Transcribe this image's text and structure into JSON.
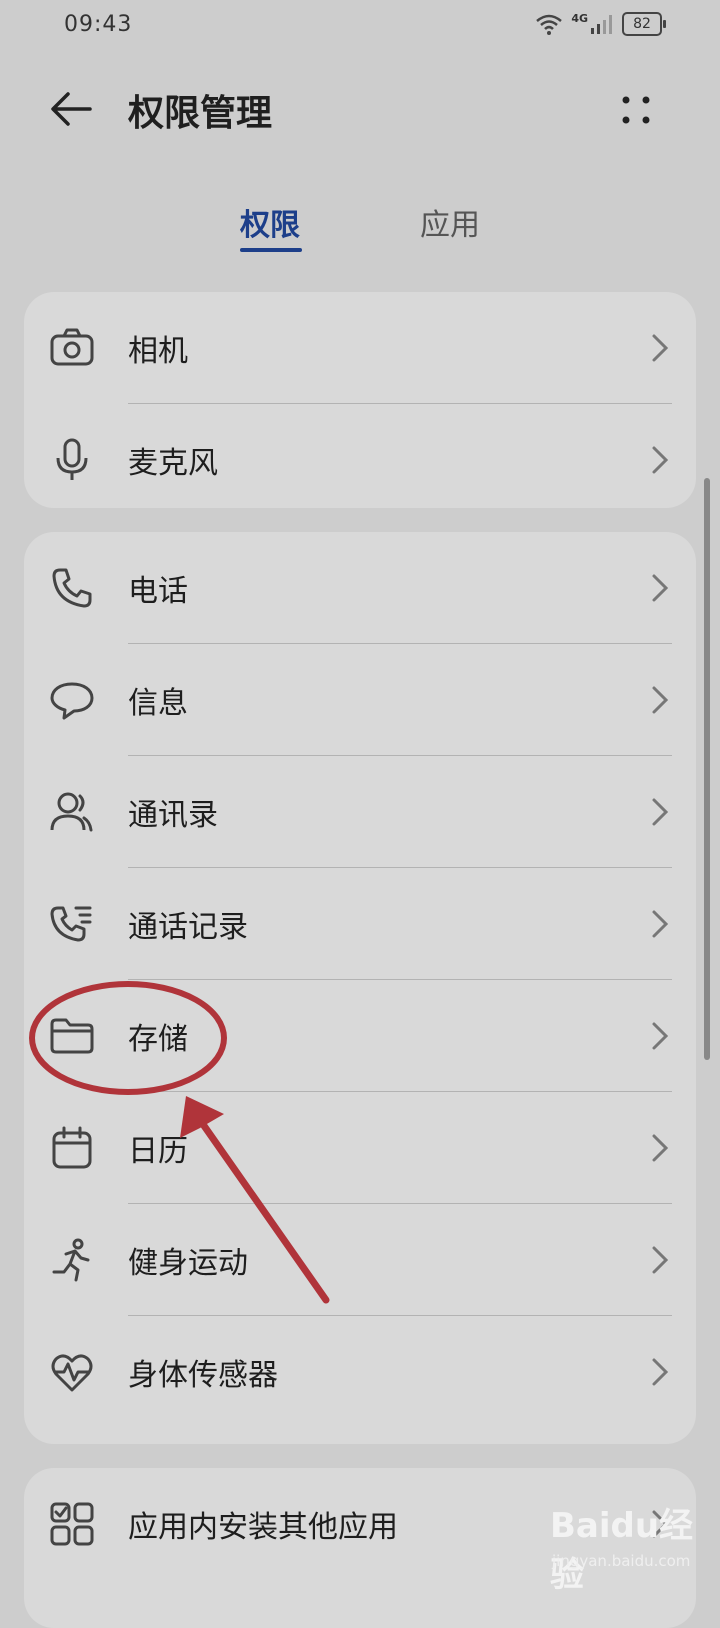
{
  "status_bar": {
    "time": "09:43",
    "network": "4G",
    "battery": "82"
  },
  "header": {
    "title": "权限管理"
  },
  "tabs": [
    {
      "label": "权限",
      "active": true
    },
    {
      "label": "应用",
      "active": false
    }
  ],
  "groups": [
    {
      "items": [
        {
          "label": "相机",
          "icon": "camera-icon"
        },
        {
          "label": "麦克风",
          "icon": "microphone-icon"
        }
      ]
    },
    {
      "items": [
        {
          "label": "电话",
          "icon": "phone-icon"
        },
        {
          "label": "信息",
          "icon": "message-icon"
        },
        {
          "label": "通讯录",
          "icon": "contacts-icon"
        },
        {
          "label": "通话记录",
          "icon": "call-log-icon"
        },
        {
          "label": "存储",
          "icon": "folder-icon"
        },
        {
          "label": "日历",
          "icon": "calendar-icon"
        },
        {
          "label": "健身运动",
          "icon": "running-icon"
        },
        {
          "label": "身体传感器",
          "icon": "heart-rate-icon"
        }
      ]
    },
    {
      "items": [
        {
          "label": "应用内安装其他应用",
          "icon": "apps-grid-icon"
        }
      ]
    }
  ],
  "watermark": {
    "brand": "Baidu经验",
    "url": "jingyan.baidu.com"
  },
  "colors": {
    "accent": "#1d3f8a",
    "annotation": "#b0343a",
    "background": "#cdcdcd",
    "card": "#d9d9d9"
  }
}
